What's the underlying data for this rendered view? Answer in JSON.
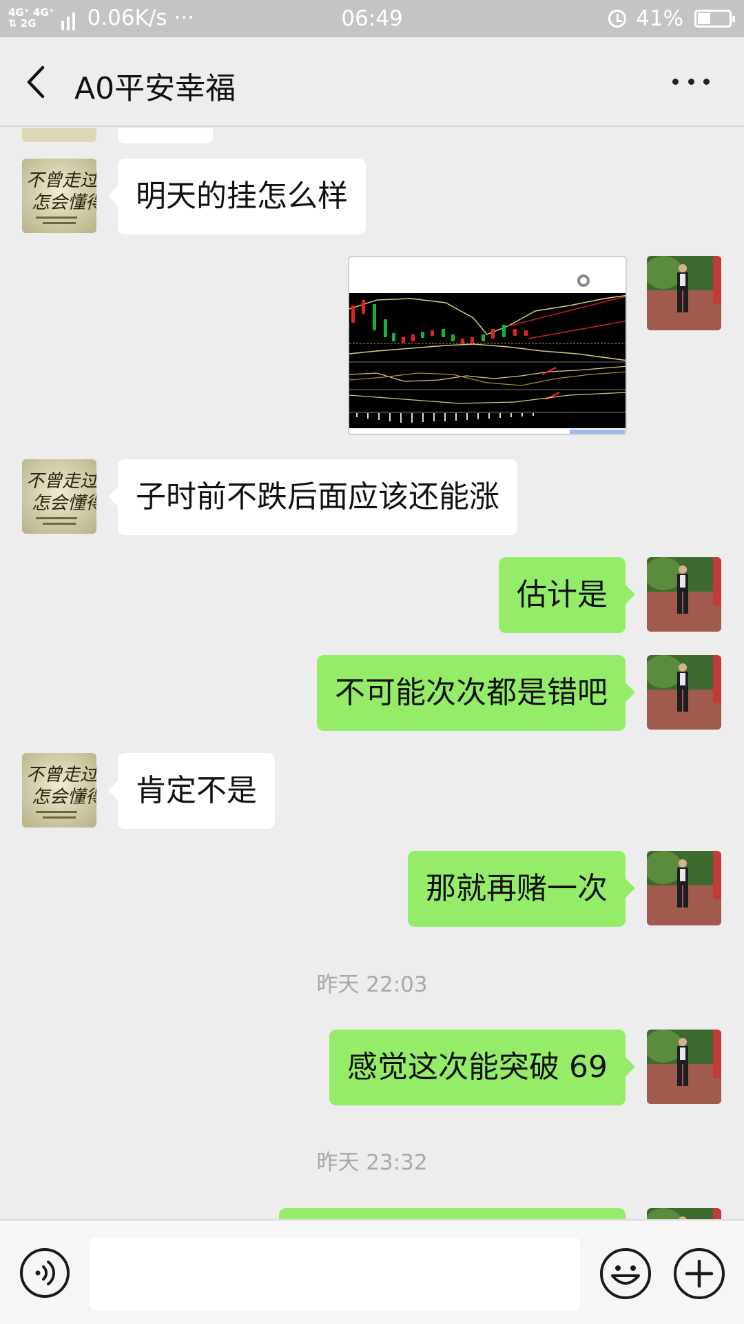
{
  "status_bar": {
    "network_top": "4G⁺ 4G⁺",
    "network_bottom": "⇅ 2G",
    "speed": "0.06K/s",
    "dots": "···",
    "time": "06:49",
    "battery": "41%",
    "battery_level": 0.41
  },
  "header": {
    "title": "A0平安幸福"
  },
  "messages": [
    {
      "type": "text",
      "sender": "other",
      "text": "明天的挂怎么样"
    },
    {
      "type": "image",
      "sender": "me",
      "description": "candlestick chart screenshot"
    },
    {
      "type": "text",
      "sender": "other",
      "text": "子时前不跌后面应该还能涨"
    },
    {
      "type": "text",
      "sender": "me",
      "text": "估计是"
    },
    {
      "type": "text",
      "sender": "me",
      "text": "不可能次次都是错吧"
    },
    {
      "type": "text",
      "sender": "other",
      "text": "肯定不是"
    },
    {
      "type": "text",
      "sender": "me",
      "text": "那就再赌一次"
    },
    {
      "type": "timestamp",
      "text": "昨天 22:03"
    },
    {
      "type": "text",
      "sender": "me",
      "text": "感觉这次能突破 69"
    },
    {
      "type": "timestamp",
      "text": "昨天 23:32"
    }
  ],
  "input_bar": {
    "placeholder": ""
  },
  "icons": {
    "back": "chevron-left-icon",
    "more": "more-dots-icon",
    "voice": "voice-icon",
    "emoji": "emoji-icon",
    "plus": "plus-icon"
  },
  "colors": {
    "background": "#ededed",
    "bubble_out": "#95ec69",
    "bubble_in": "#ffffff",
    "status_bar": "#c4c4c4"
  }
}
